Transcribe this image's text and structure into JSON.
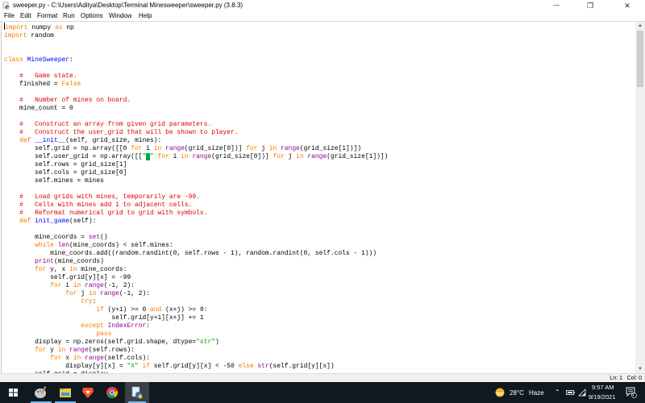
{
  "window": {
    "title": "sweeper.py - C:\\Users\\Aditya\\Desktop\\Terminal Minesweeper\\sweeper.py (3.8.3)",
    "controls": {
      "minimize": "—",
      "maximize": "❐",
      "close": "✕"
    }
  },
  "menu": {
    "items": [
      "File",
      "Edit",
      "Format",
      "Run",
      "Options",
      "Window",
      "Help"
    ]
  },
  "editor": {
    "lines": [
      "import numpy as np",
      "import random",
      "",
      "",
      "class MineSweeper:",
      "",
      "    #   Game state.",
      "    finished = False",
      "",
      "    #   Number of mines on board.",
      "    mine_count = 0",
      "",
      "    #   Construct an array from given grid parameters.",
      "    #   Construct the user_grid that will be shown to player.",
      "    def __init__(self, grid_size, mines):",
      "        self.grid = np.array([[0 for i in range(grid_size[0])] for j in range(grid_size[1])])",
      "        self.user_grid = np.array([[\"#\" for i in range(grid_size[0])] for j in range(grid_size[1])])",
      "        self.rows = grid_size[1]",
      "        self.cols = grid_size[0]",
      "        self.mines = mines",
      "",
      "    #   Load grids with mines, temporarily are -99.",
      "    #   Cells with mines add 1 to adjacent cells.",
      "    #   Reformat numerical grid to grid with symbols.",
      "    def init_game(self):",
      "",
      "        mine_coords = set()",
      "        while len(mine_coords) < self.mines:",
      "            mine_coords.add((random.randint(0, self.rows - 1), random.randint(0, self.cols - 1)))",
      "        print(mine_coords)",
      "        for y, x in mine_coords:",
      "            self.grid[y][x] = -99",
      "            for i in range(-1, 2):",
      "                for j in range(-1, 2):",
      "                    try:",
      "                        if (y+i) >= 0 and (x+j) >= 0:",
      "                            self.grid[y+i][x+j] += 1",
      "                    except IndexError:",
      "                        pass",
      "        display = np.zeros(self.grid.shape, dtype=\"str\")",
      "        for y in range(self.rows):",
      "            for x in range(self.cols):",
      "                display[y][x] = \"X\" if self.grid[y][x] < -50 else str(self.grid[y][x])",
      "        self.grid = display"
    ],
    "cursor": {
      "line": 1,
      "col": 0
    }
  },
  "status": {
    "ln": "Ln: 1",
    "col": "Col: 0"
  },
  "taskbar": {
    "apps": [
      {
        "name": "start",
        "icon": "windows-logo-icon"
      },
      {
        "name": "paint",
        "icon": "paint-palette-icon"
      },
      {
        "name": "file-explorer",
        "icon": "folder-icon"
      },
      {
        "name": "brave",
        "icon": "brave-lion-icon"
      },
      {
        "name": "chrome",
        "icon": "chrome-icon"
      },
      {
        "name": "python-idle",
        "icon": "python-file-icon",
        "active": true
      }
    ],
    "weather": {
      "temp": "28°C",
      "condition": "Haze"
    },
    "time": "9:57 AM",
    "date": "9/19/2021",
    "notifications": "1"
  }
}
